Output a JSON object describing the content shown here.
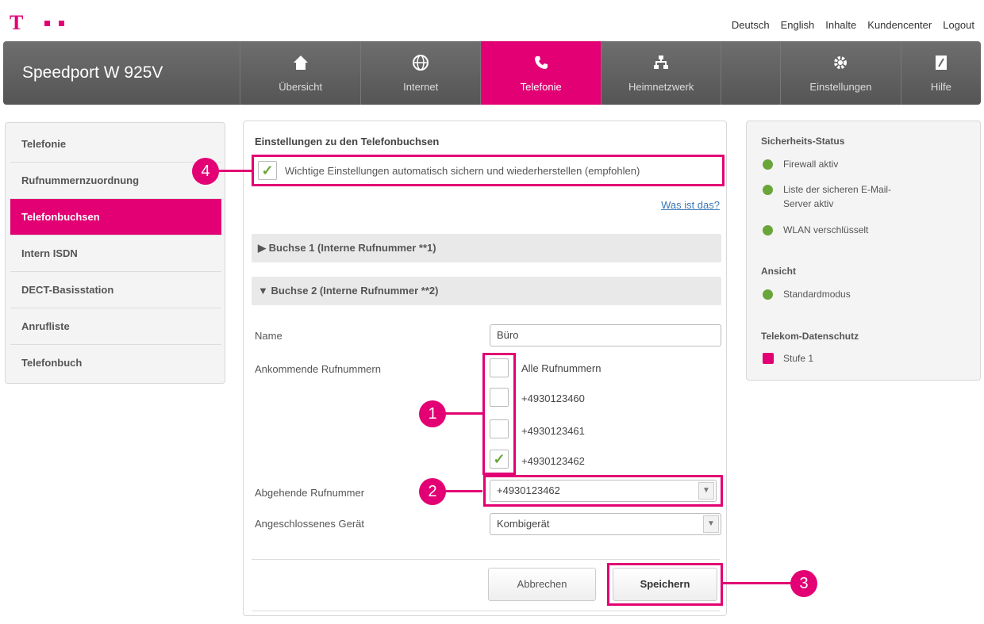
{
  "top_links": [
    "Deutsch",
    "English",
    "Inhalte",
    "Kundencenter",
    "Logout"
  ],
  "nav": {
    "brand": "Speedport W 925V",
    "tabs": [
      {
        "label": "Übersicht",
        "icon": "home-icon"
      },
      {
        "label": "Internet",
        "icon": "globe-icon"
      },
      {
        "label": "Telefonie",
        "icon": "phone-icon",
        "active": true
      },
      {
        "label": "Heimnetzwerk",
        "icon": "network-icon"
      },
      {
        "label": "",
        "icon": ""
      },
      {
        "label": "Einstellungen",
        "icon": "gear-icon"
      },
      {
        "label": "Hilfe",
        "icon": "help-icon"
      }
    ]
  },
  "sidebar": {
    "items": [
      {
        "label": "Telefonie"
      },
      {
        "label": "Rufnummernzuordnung"
      },
      {
        "label": "Telefonbuchsen",
        "active": true
      },
      {
        "label": "Intern ISDN"
      },
      {
        "label": "DECT-Basisstation"
      },
      {
        "label": "Anrufliste"
      },
      {
        "label": "Telefonbuch"
      }
    ]
  },
  "main": {
    "title": "Einstellungen zu den Telefonbuchsen",
    "auto_save_label": "Wichtige Einstellungen automatisch sichern und wiederherstellen (empfohlen)",
    "auto_save_checked": true,
    "help_link": "Was ist das?",
    "jack1": "Buchse 1 (Interne Rufnummer **1)",
    "jack2": "Buchse 2 (Interne Rufnummer **2)",
    "name_label": "Name",
    "name_value": "Büro",
    "incoming_label": "Ankommende Rufnummern",
    "incoming_options": [
      {
        "label": "Alle Rufnummern",
        "checked": false
      },
      {
        "label": "+4930123460",
        "checked": false
      },
      {
        "label": "+4930123461",
        "checked": false
      },
      {
        "label": "+4930123462",
        "checked": true
      }
    ],
    "outgoing_label": "Abgehende Rufnummer",
    "outgoing_value": "+4930123462",
    "device_label": "Angeschlossenes Gerät",
    "device_value": "Kombigerät",
    "cancel_label": "Abbrechen",
    "save_label": "Speichern"
  },
  "callouts": [
    "4",
    "1",
    "2",
    "3"
  ],
  "right_panel": {
    "security_title": "Sicherheits-Status",
    "security_items": [
      "Firewall aktiv",
      "Liste der sicheren E-Mail-Server aktiv",
      "WLAN verschlüsselt"
    ],
    "view_title": "Ansicht",
    "view_items": [
      "Standardmodus"
    ],
    "privacy_title": "Telekom-Datenschutz",
    "privacy_items": [
      "Stufe 1"
    ]
  },
  "colors": {
    "accent": "#e20074",
    "check": "#6aa53a",
    "nav_bg": "#606060"
  }
}
